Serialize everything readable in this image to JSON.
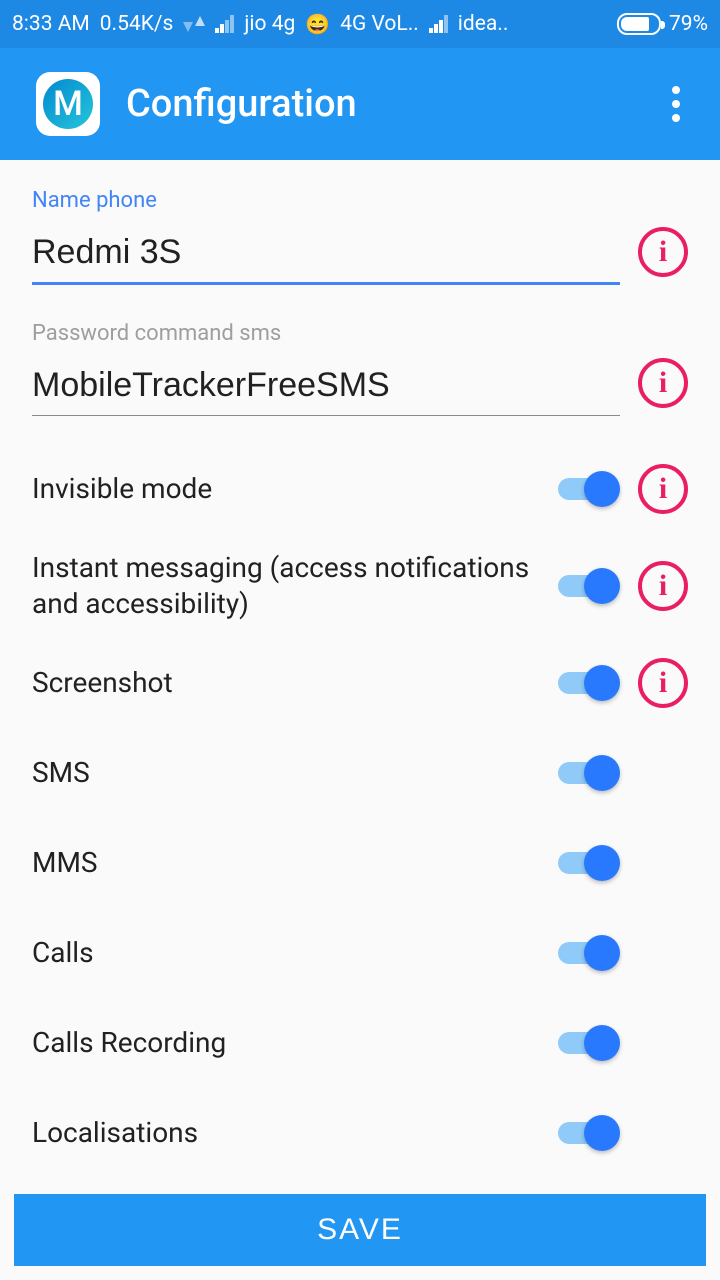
{
  "status": {
    "time": "8:33 AM",
    "speed": "0.54K/s",
    "carrier1": "jio 4g",
    "net_label": "4G VoL..",
    "carrier2": "idea..",
    "battery_pct": "79%"
  },
  "appbar": {
    "logo_letter": "M",
    "title": "Configuration"
  },
  "fields": {
    "name_phone_label": "Name phone",
    "name_phone_value": "Redmi 3S",
    "password_label": "Password command sms",
    "password_value": "MobileTrackerFreeSMS"
  },
  "toggles": {
    "invisible": "Invisible mode",
    "im": "Instant messaging (access notifications and accessibility)",
    "screenshot": "Screenshot",
    "sms": "SMS",
    "mms": "MMS",
    "calls": "Calls",
    "calls_rec": "Calls Recording",
    "local": "Localisations"
  },
  "save_label": "SAVE",
  "info_glyph": "i",
  "emoji": "😄"
}
